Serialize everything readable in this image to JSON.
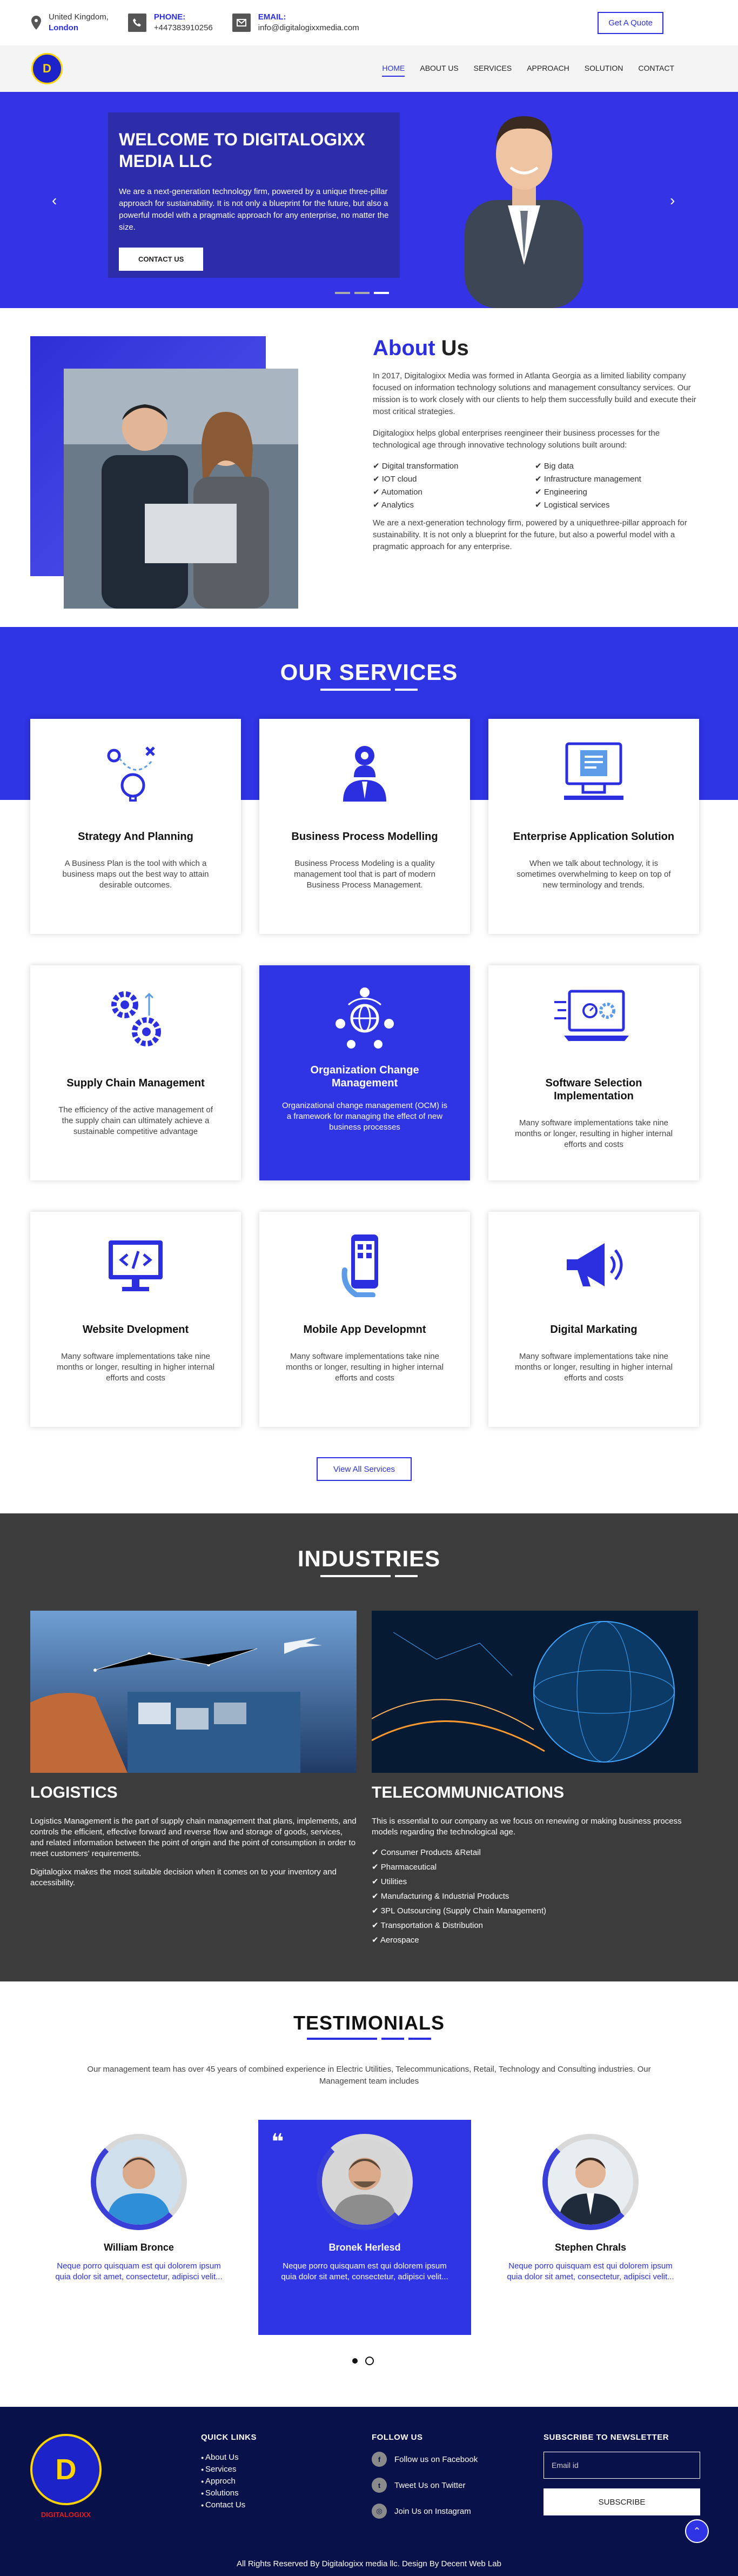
{
  "topbar": {
    "location_line1": "United Kingdom,",
    "location_line2": "London",
    "phone_label": "PHONE:",
    "phone_value": "+447383910256",
    "email_label": "EMAIL:",
    "email_value": "info@digitalogixxmedia.com",
    "quote_button": "Get A Quote"
  },
  "nav": {
    "logo_letter": "D",
    "items": [
      "HOME",
      "ABOUT US",
      "SERVICES",
      "APPROACH",
      "SOLUTION",
      "CONTACT"
    ]
  },
  "hero": {
    "title": "WELCOME TO DIGITALOGIXX MEDIA LLC",
    "text": "We are a next-generation technology firm, powered by a unique three-pillar approach for sustainability. It is not only a blueprint for the future, but also a powerful model with a pragmatic approach for any enterprise, no matter the size.",
    "button": "CONTACT US",
    "prev_arrow": "‹",
    "next_arrow": "›"
  },
  "about": {
    "title_accent": "About",
    "title_rest": " Us",
    "para1": "In 2017, Digitalogixx Media was formed in Atlanta Georgia as a limited liability company focused on information technology solutions and management consultancy services. Our mission is to work closely with our clients to help them successfully build and execute their most critical strategies.",
    "para2": "Digitalogixx helps global enterprises reengineer their business processes for the technological age through innovative technology solutions built around:",
    "list": [
      "Digital transformation",
      "Big data",
      "IOT cloud",
      "Infrastructure management",
      "Automation",
      "Engineering",
      "Analytics",
      "Logistical services"
    ],
    "para3": "We are a next-generation technology firm, powered by a uniquethree-pillar approach for sustainability. It is not only a blueprint for the future, but also a powerful model with a pragmatic approach for any enterprise."
  },
  "services": {
    "title": "OUR SERVICES",
    "items": [
      {
        "title": "Strategy And Planning",
        "text": "A Business Plan is the tool with which a business maps out the best way to attain desirable outcomes.",
        "icon": "strategy-icon"
      },
      {
        "title": "Business Process Modelling",
        "text": "Business Process Modeling is a quality management tool that is part of modern Business Process Management.",
        "icon": "process-user-icon"
      },
      {
        "title": "Enterprise Application Solution",
        "text": "When we talk about technology, it is sometimes overwhelming to keep on top of new terminology and trends.",
        "icon": "application-icon"
      },
      {
        "title": "Supply Chain Management",
        "text": "The efficiency of the active management of the supply chain can ultimately achieve a sustainable competitive advantage",
        "icon": "gears-icon"
      },
      {
        "title": "Organization Change Management",
        "text": "Organizational change management (OCM) is a framework for managing the effect of new business processes",
        "icon": "globe-network-icon"
      },
      {
        "title": "Software Selection Implementation",
        "text": "Many software implementations take nine months or longer, resulting in higher internal efforts and costs",
        "icon": "laptop-settings-icon"
      },
      {
        "title": "Website Dvelopment",
        "text": "Many software implementations take nine months or longer, resulting in higher internal efforts and costs",
        "icon": "code-monitor-icon"
      },
      {
        "title": "Mobile App Developmnt",
        "text": "Many software implementations take nine months or longer, resulting in higher internal efforts and costs",
        "icon": "mobile-app-icon"
      },
      {
        "title": "Digital Markating",
        "text": "Many software implementations take nine months or longer, resulting in higher internal efforts and costs",
        "icon": "megaphone-icon"
      }
    ],
    "view_all": "View All Services"
  },
  "industries": {
    "title": "INDUSTRIES",
    "logistics": {
      "title": "LOGISTICS",
      "para1": "Logistics Management is the part of supply chain management that plans, implements, and controls the efficient, effective forward and reverse flow and storage of goods, services, and related information between the point of origin and the point of consumption in order to meet customers' requirements.",
      "para2": "Digitalogixx makes the most suitable decision when it comes on to your inventory and accessibility."
    },
    "telecom": {
      "title": "TELECOMMUNICATIONS",
      "para": "This is essential to our company as we focus on renewing or making business process models regarding the technological age.",
      "list": [
        "Consumer Products &Retail",
        "Pharmaceutical",
        "Utilities",
        "Manufacturing & Industrial Products",
        "3PL Outsourcing (Supply Chain Management)",
        "Transportation & Distribution",
        "Aerospace"
      ]
    }
  },
  "testimonials": {
    "title": "TESTIMONIALS",
    "intro": "Our management team has over 45 years of combined experience in Electric Utilities, Telecommunications, Retail, Technology and Consulting industries. Our Management team includes",
    "quote_mark": "❝",
    "items": [
      {
        "name": "William Bronce",
        "text": "Neque porro quisquam est qui dolorem ipsum quia dolor sit amet, consectetur, adipisci velit..."
      },
      {
        "name": "Bronek Herlesd",
        "text": "Neque porro quisquam est qui dolorem ipsum quia dolor sit amet, consectetur, adipisci velit..."
      },
      {
        "name": "Stephen Chrals",
        "text": "Neque porro quisquam est qui dolorem ipsum quia dolor sit amet, consectetur, adipisci velit..."
      }
    ]
  },
  "footer": {
    "logo_letter": "D",
    "logo_text": "DIGITALOGIXX",
    "quick_links_title": "QUICK LINKS",
    "quick_links": [
      "About Us",
      "Services",
      "Approch",
      "Solutions",
      "Contact Us"
    ],
    "follow_title": "FOLLOW US",
    "follow": [
      {
        "label": "Follow us on Facebook",
        "glyph": "f"
      },
      {
        "label": "Tweet Us on Twitter",
        "glyph": "t"
      },
      {
        "label": "Join Us on Instagram",
        "glyph": "◎"
      }
    ],
    "newsletter_title": "SUBSCRIBE TO NEWSLETTER",
    "email_placeholder": "Email id",
    "subscribe": "SUBSCRIBE",
    "to_top": "⌃",
    "copyright": "All Rights Reserved By Digitalogixx media llc. Design By Decent Web Lab"
  },
  "colors": {
    "accent": "#2b2fe0",
    "hero_bg": "#3433e6",
    "dark_section": "#3c3c3c",
    "footer_bg": "#09114a"
  }
}
